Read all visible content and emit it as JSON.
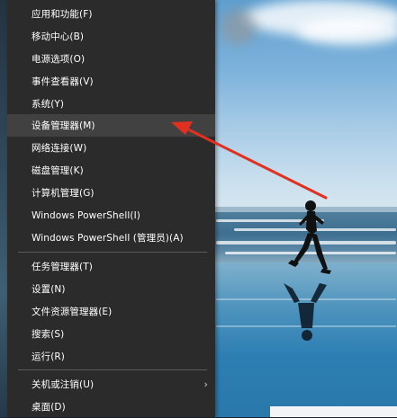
{
  "menu": {
    "items": [
      {
        "label": "应用和功能(F)"
      },
      {
        "label": "移动中心(B)"
      },
      {
        "label": "电源选项(O)"
      },
      {
        "label": "事件查看器(V)"
      },
      {
        "label": "系统(Y)"
      },
      {
        "label": "设备管理器(M)"
      },
      {
        "label": "网络连接(W)"
      },
      {
        "label": "磁盘管理(K)"
      },
      {
        "label": "计算机管理(G)"
      },
      {
        "label": "Windows PowerShell(I)"
      },
      {
        "label": "Windows PowerShell (管理员)(A)"
      },
      {
        "label": "任务管理器(T)"
      },
      {
        "label": "设置(N)"
      },
      {
        "label": "文件资源管理器(E)"
      },
      {
        "label": "搜索(S)"
      },
      {
        "label": "运行(R)"
      },
      {
        "label": "关机或注销(U)"
      },
      {
        "label": "桌面(D)"
      }
    ],
    "highlighted_label": "设备管理器(M)",
    "submenu_icon": "chevron-right-icon"
  },
  "annotation": {
    "type": "red-arrow",
    "color": "#e03020",
    "points_to": "设备管理器(M)"
  },
  "colors": {
    "menu_bg": "#2b2b2b",
    "menu_text": "#ffffff",
    "highlight_bg": "#414141"
  }
}
